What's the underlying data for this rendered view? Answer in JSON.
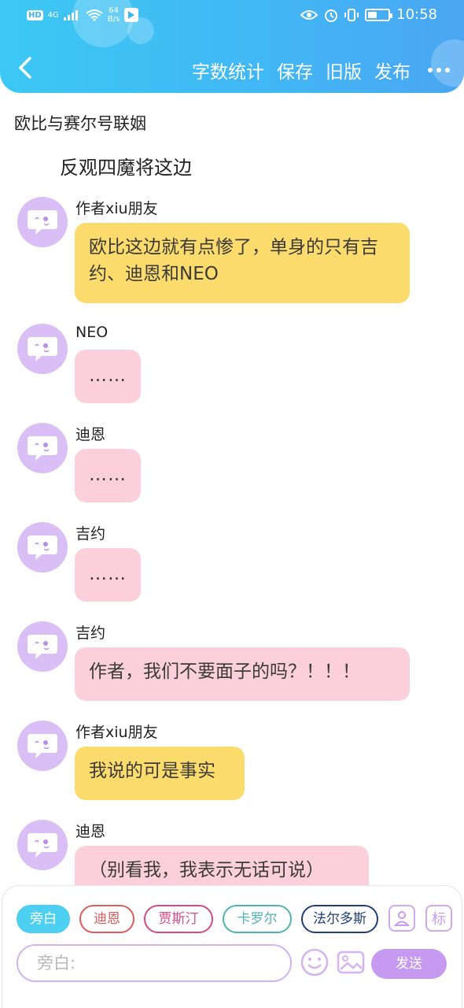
{
  "status_bar": {
    "left_badge": "HD",
    "network": "4G",
    "speed_value": "64",
    "speed_unit": "B/s",
    "battery_level": 0.45,
    "time": "10:58"
  },
  "header": {
    "actions": [
      "字数统计",
      "保存",
      "旧版",
      "发布"
    ],
    "colors": {
      "gradient_start": "#3cc8f4",
      "gradient_end": "#4aa6f2"
    }
  },
  "story": {
    "title": "欧比与赛尔号联姻",
    "narration": "反观四魔将这边"
  },
  "messages": [
    {
      "speaker": "作者xiu朋友",
      "text": "欧比这边就有点惨了，单身的只有吉约、迪恩和NEO",
      "style": "yellow"
    },
    {
      "speaker": "NEO",
      "text": "……",
      "style": "pink"
    },
    {
      "speaker": "迪恩",
      "text": "……",
      "style": "pink"
    },
    {
      "speaker": "吉约",
      "text": "……",
      "style": "pink"
    },
    {
      "speaker": "吉约",
      "text": "作者，我们不要面子的吗？！！！",
      "style": "pink"
    },
    {
      "speaker": "作者xiu朋友",
      "text": "我说的可是事实",
      "style": "yellow"
    },
    {
      "speaker": "迪恩",
      "text": "（别看我，我表示无话可说）",
      "style": "pink"
    }
  ],
  "composer": {
    "characters": [
      {
        "label": "旁白",
        "color": "#4ccff0",
        "active": true
      },
      {
        "label": "迪恩",
        "color": "#e05a5a",
        "active": false
      },
      {
        "label": "贾斯汀",
        "color": "#d24a86",
        "active": false
      },
      {
        "label": "卡罗尔",
        "color": "#4fb3b3",
        "active": false
      },
      {
        "label": "法尔多斯",
        "color": "#1f3f7a",
        "active": false
      }
    ],
    "tag_icon_label": "标",
    "input_placeholder": "旁白:",
    "send_label": "发送",
    "accent": "#c59af0"
  }
}
